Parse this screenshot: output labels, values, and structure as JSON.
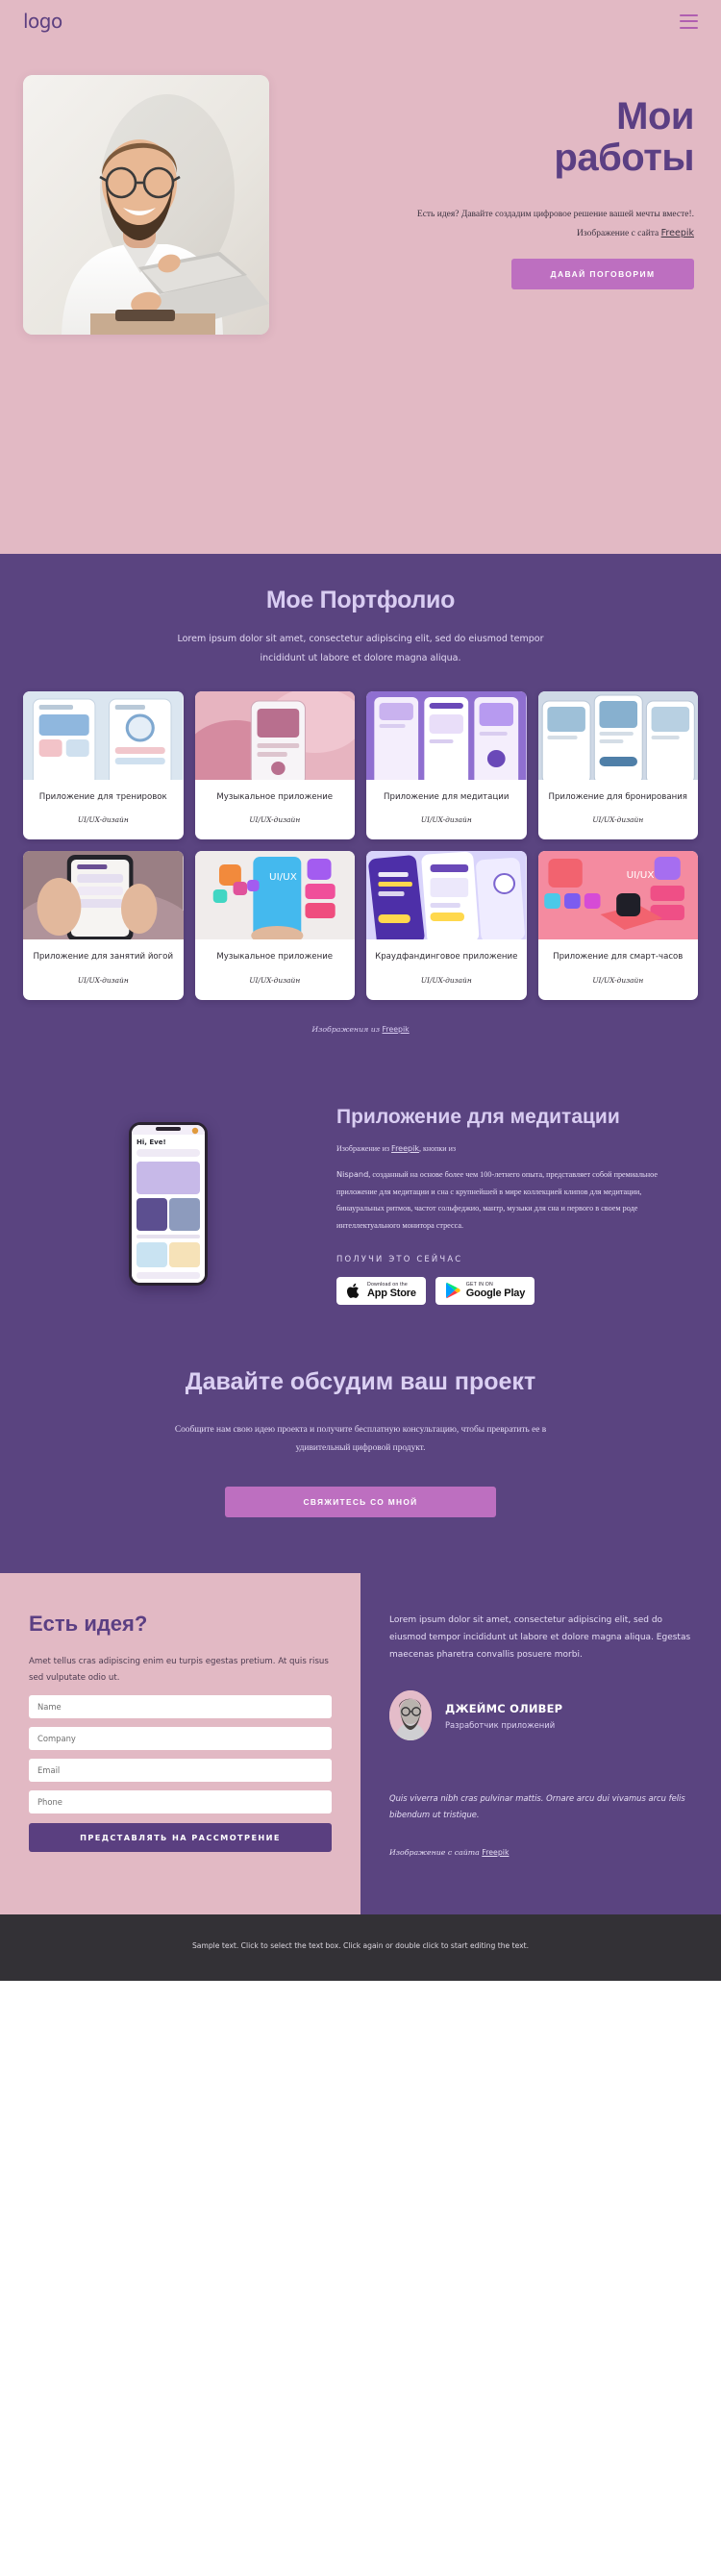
{
  "header": {
    "logo": "logo",
    "menu_icon": "hamburger-menu-icon"
  },
  "hero": {
    "title_line1": "Мои",
    "title_line2": "работы",
    "subtitle_part1": "Есть идея? Давайте создадим цифровое решение вашей мечты вместе!. Изображение с сайта ",
    "subtitle_link": "Freepik",
    "cta_label": "ДАВАЙ ПОГОВОРИМ",
    "bg_color": "#e2b9c4",
    "title_color": "#5b3f83",
    "cta_color": "#bd6fc0"
  },
  "portfolio": {
    "title": "Мое Портфолио",
    "subtitle": "Lorem ipsum dolor sit amet, consectetur adipiscing elit, sed do eiusmod tempor incididunt ut labore et dolore magna aliqua.",
    "bg_color": "#5a4480",
    "cards": [
      {
        "title": "Приложение для тренировок",
        "tag": "UI/UX-дизайн"
      },
      {
        "title": "Музыкальное приложение",
        "tag": "UI/UX-дизайн"
      },
      {
        "title": "Приложение для медитации",
        "tag": "UI/UX-дизайн"
      },
      {
        "title": "Приложение для бронирования",
        "tag": "UI/UX-дизайн"
      },
      {
        "title": "Приложение для занятий йогой",
        "tag": "UI/UX-дизайн"
      },
      {
        "title": "Музыкальное приложение",
        "tag": "UI/UX-дизайн"
      },
      {
        "title": "Краудфандинговое приложение",
        "tag": "UI/UX-дизайн"
      },
      {
        "title": "Приложение для смарт-часов",
        "tag": "UI/UX-дизайн"
      }
    ],
    "credit_text": "Изображения из ",
    "credit_link": "Freepik"
  },
  "app_section": {
    "title": "Приложение для медитации",
    "credit_prefix": "Изображение из ",
    "credit_link": "Freepik",
    "credit_suffix": ", кнопки из",
    "brand": "Nispand",
    "paragraph": ", созданный на основе более чем 100-летнего опыта, представляет собой премиальное приложение для медитации и сна с крупнейшей в мире коллекцией клипов для медитации, бинауральных ритмов, частот сольфеджио, мантр, музыки для сна и первого в своем роде интеллектуального монитора стресса.",
    "kicker": "ПОЛУЧИ ЭТО СЕЙЧАС",
    "phone_greeting": "Hi, Eve!",
    "stores": [
      {
        "small": "Download on the",
        "big": "App Store",
        "icon": "apple-icon"
      },
      {
        "small": "GET IN ON",
        "big": "Google Play",
        "icon": "google-play-icon"
      }
    ]
  },
  "discuss": {
    "title": "Давайте обсудим ваш проект",
    "paragraph": "Сообщите нам свою идею проекта и получите бесплатную консультацию, чтобы превратить ее в удивительный цифровой продукт.",
    "cta_label": "СВЯЖИТЕСЬ СО МНОЙ"
  },
  "contact": {
    "title": "Есть идея?",
    "lead": "Amet tellus cras adipiscing enim eu turpis egestas pretium. At quis risus sed vulputate odio ut.",
    "fields": [
      {
        "name": "name",
        "placeholder": "Name",
        "value": ""
      },
      {
        "name": "company",
        "placeholder": "Company",
        "value": ""
      },
      {
        "name": "email",
        "placeholder": "Email",
        "value": ""
      },
      {
        "name": "phone",
        "placeholder": "Phone",
        "value": ""
      }
    ],
    "submit_label": "ПРЕДСТАВЛЯТЬ НА РАССМОТРЕНИЕ"
  },
  "testimonial": {
    "body": "Lorem ipsum dolor sit amet, consectetur adipiscing elit, sed do eiusmod tempor incididunt ut labore et dolore magna aliqua. Egestas maecenas pharetra convallis posuere morbi.",
    "person_name": "ДЖЕЙМС ОЛИВЕР",
    "person_role": "Разработчик приложений",
    "quote": "Quis viverra nibh cras pulvinar mattis. Ornare arcu dui vivamus arcu felis bibendum ut tristique.",
    "credit_prefix": "Изображение с сайта ",
    "credit_link": "Freepik"
  },
  "footer": {
    "text": "Sample text. Click to select the text box. Click again or double click to start editing the text."
  }
}
